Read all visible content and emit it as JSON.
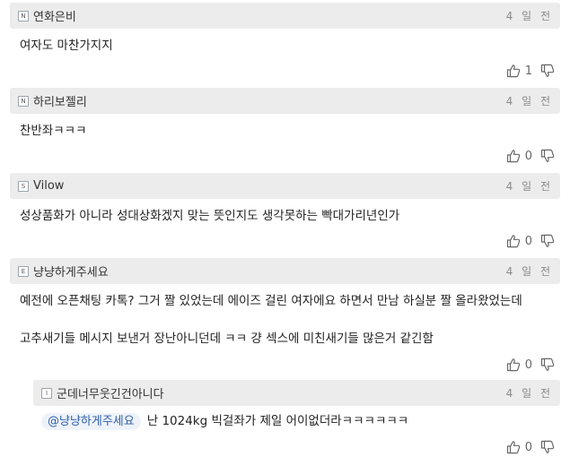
{
  "comments": [
    {
      "badge": "N",
      "nick": "연화은비",
      "time": "4 일 전",
      "body": "여자도 마찬가지지",
      "likes": "1"
    },
    {
      "badge": "N",
      "nick": "하리보젤리",
      "time": "4 일 전",
      "body": "찬반좌ㅋㅋㅋ",
      "likes": "0"
    },
    {
      "badge": "S",
      "nick": "Vilow",
      "time": "4 일 전",
      "body": "성상품화가 아니라 성대상화겠지 맞는 뜻인지도 생각못하는 빡대가리년인가",
      "likes": "0"
    },
    {
      "badge": "E",
      "nick": "냥냥하게주세요",
      "time": "4 일 전",
      "body": "예전에 오픈채팅 카톡? 그거 짤 있었는데 에이즈 걸린 여자에요 하면서 만남 하실분 짤 올라왔었는데\n\n고추새기들 메시지 보낸거 장난아니던데 ㅋㅋ 걍 섹스에 미친새기들 많은거 같긴함",
      "likes": "0"
    }
  ],
  "reply": {
    "badge": "I",
    "nick": "군데너무웃긴건아니다",
    "time": "4 일 전",
    "mention": "@냥냥하게주세요",
    "body": "난 1024kg 빅걸좌가 제일 어이없더라ㅋㅋㅋㅋㅋㅋ",
    "likes": "0"
  }
}
